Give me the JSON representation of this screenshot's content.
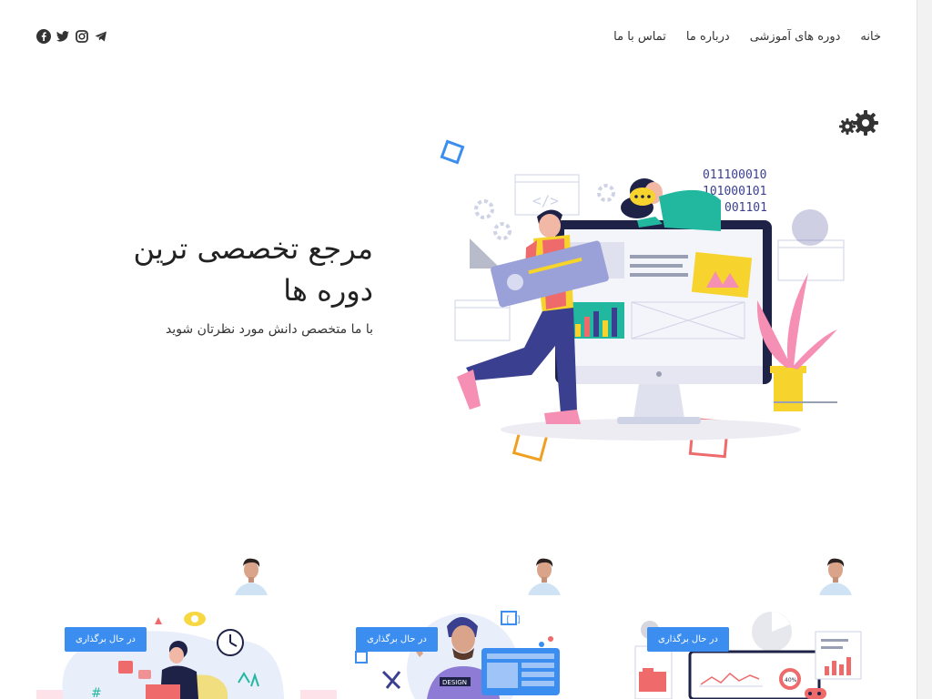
{
  "nav": {
    "items": [
      "خانه",
      "دوره های آموزشی",
      "درباره ما",
      "تماس با ما"
    ]
  },
  "social": {
    "icons": [
      "telegram-icon",
      "instagram-icon",
      "twitter-icon",
      "facebook-icon"
    ]
  },
  "hero": {
    "title": "مرجع تخصصی ترین دوره ها",
    "subtitle": "با ما متخصص دانش مورد نظرتان شوید",
    "binary_lines": [
      "011100010",
      "101000101",
      "001101"
    ]
  },
  "courses": [
    {
      "status": "در حال برگذاری"
    },
    {
      "status": "در حال برگذاری"
    },
    {
      "status": "در حال برگذاری"
    }
  ],
  "colors": {
    "accent": "#3b8df0",
    "yellow": "#f6d32d",
    "teal": "#22b8a0",
    "indigo": "#3a3f8f",
    "pink": "#f58fb4"
  }
}
